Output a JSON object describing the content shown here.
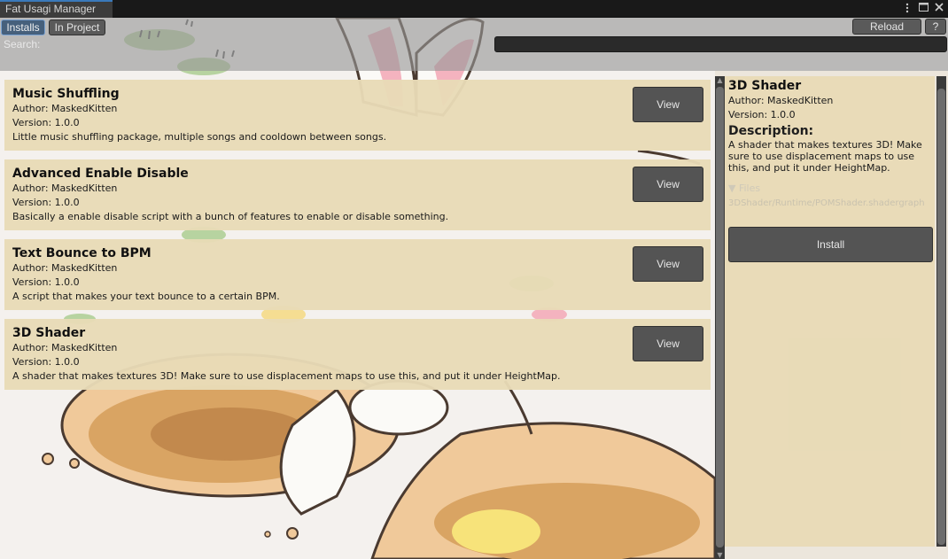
{
  "window": {
    "title": "Fat Usagi Manager",
    "controls": [
      "more-icon",
      "maximize-icon",
      "close-icon"
    ]
  },
  "toolbar": {
    "tabs": [
      {
        "label": "Installs",
        "active": true
      },
      {
        "label": "In Project",
        "active": false
      }
    ],
    "reload_label": "Reload",
    "help_label": "?",
    "search_label": "Search:",
    "search_value": ""
  },
  "packages": [
    {
      "name": "Music Shuffling",
      "author": "Author: MaskedKitten",
      "version": "Version: 1.0.0",
      "description": "Little music shuffling package, multiple songs and cooldown between songs.",
      "button": "View"
    },
    {
      "name": "Advanced Enable Disable",
      "author": "Author: MaskedKitten",
      "version": "Version: 1.0.0",
      "description": "Basically a enable disable script with a bunch of features to enable or disable something.",
      "button": "View"
    },
    {
      "name": "Text Bounce to BPM",
      "author": "Author: MaskedKitten",
      "version": "Version: 1.0.0",
      "description": "A script that makes your text bounce to a certain BPM.",
      "button": "View"
    },
    {
      "name": "3D Shader",
      "author": "Author: MaskedKitten",
      "version": "Version: 1.0.0",
      "description": "A shader that makes textures 3D! Make sure to use displacement maps to use this, and put it under HeightMap.",
      "button": "View"
    }
  ],
  "detail": {
    "name": "3D Shader",
    "author": "Author: MaskedKitten",
    "version": "Version: 1.0.0",
    "description_heading": "Description:",
    "description": "A shader that makes textures 3D! Make sure to use displacement maps to use this, and put it under HeightMap.",
    "files_label": "Files",
    "files": [
      "3DShader/Runtime/POMShader.shadergraph"
    ],
    "install_label": "Install"
  },
  "colors": {
    "accent": "#3a79bb",
    "card_bg": "#e8dbb6",
    "button_bg": "#545454"
  }
}
